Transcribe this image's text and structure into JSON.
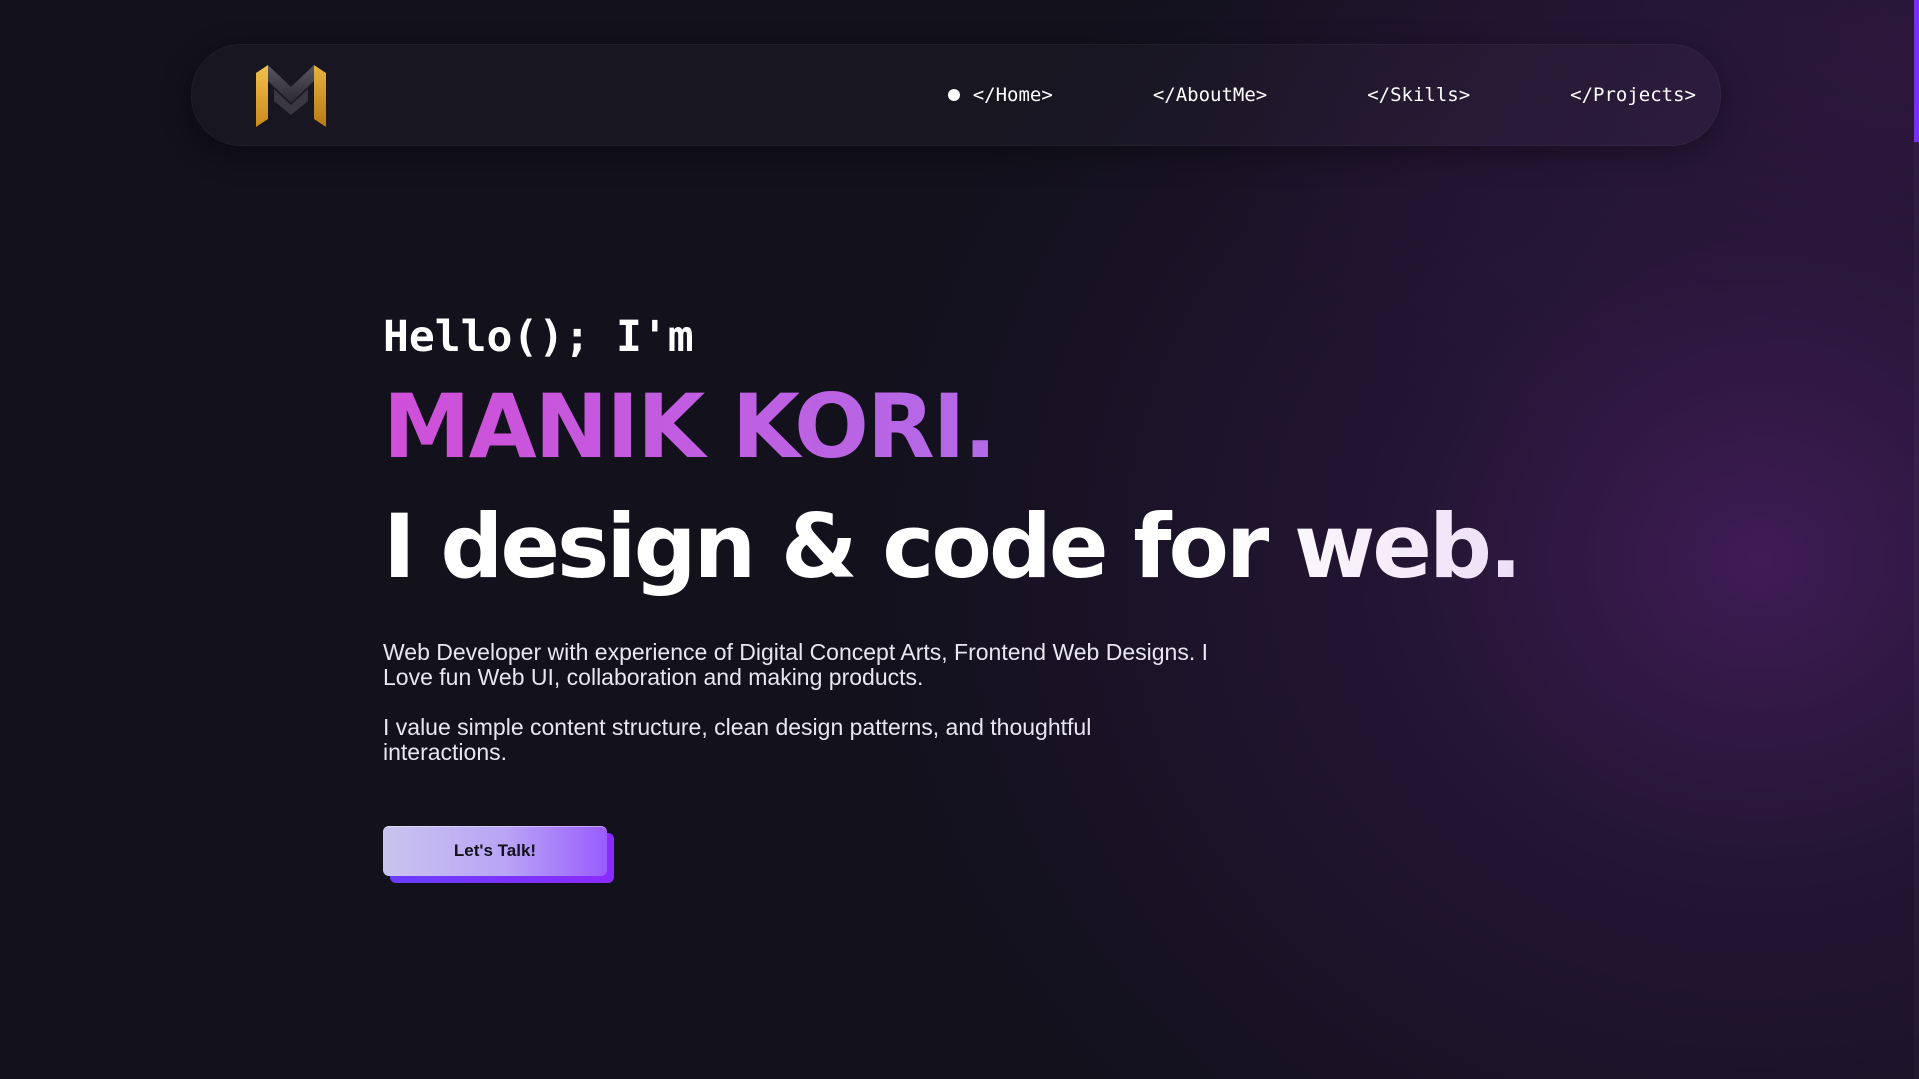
{
  "nav": {
    "logo_icon": "m-monogram-logo-icon",
    "items": [
      {
        "label": "</Home>",
        "active": true
      },
      {
        "label": "</AboutMe>",
        "active": false
      },
      {
        "label": "</Skills>",
        "active": false
      },
      {
        "label": "</Projects>",
        "active": false
      }
    ]
  },
  "hero": {
    "greeting": "Hello(); I'm",
    "name": "MANIK KORI.",
    "tagline": "I design & code for web.",
    "paragraph1": "Web Developer with experience of Digital Concept Arts, Frontend Web Designs. I Love fun Web UI, collaboration and making products.",
    "paragraph2": "I value simple content structure, clean design patterns, and thoughtful interactions.",
    "cta_label": "Let's Talk!"
  },
  "colors": {
    "background": "#12111c",
    "accent_purple": "#8a2cff",
    "name_gradient_start": "#d04fd8",
    "name_gradient_end": "#8a86f0",
    "logo_gold": "#e0a535"
  }
}
